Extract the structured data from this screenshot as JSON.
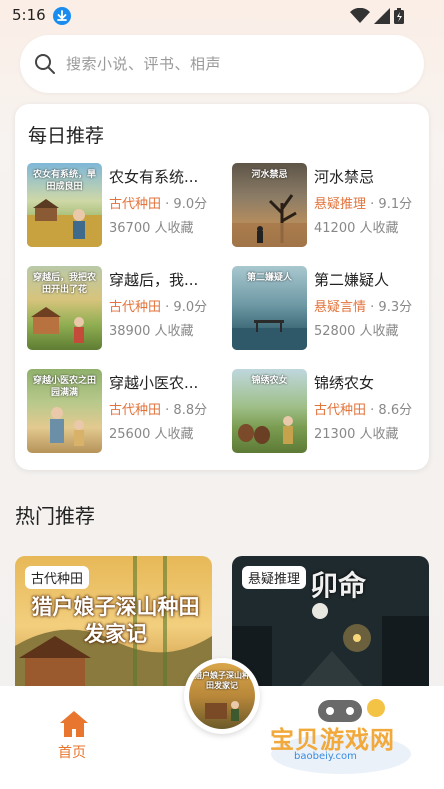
{
  "status_bar": {
    "time": "5:16"
  },
  "search": {
    "placeholder": "搜索小说、评书、相声"
  },
  "daily": {
    "title": "每日推荐",
    "books": [
      {
        "title": "农女有系统...",
        "genre": "古代种田",
        "score": "9.0分",
        "favorites": "36700 人收藏",
        "cover_text": "农女有系统，旱田成良田"
      },
      {
        "title": "河水禁忌",
        "genre": "悬疑推理",
        "score": "9.1分",
        "favorites": "41200 人收藏",
        "cover_text": "河水禁忌"
      },
      {
        "title": "穿越后，我...",
        "genre": "古代种田",
        "score": "9.0分",
        "favorites": "38900 人收藏",
        "cover_text": "穿越后，我把农田开出了花"
      },
      {
        "title": "第二嫌疑人",
        "genre": "悬疑言情",
        "score": "9.3分",
        "favorites": "52800 人收藏",
        "cover_text": "第二嫌疑人"
      },
      {
        "title": "穿越小医农...",
        "genre": "古代种田",
        "score": "8.8分",
        "favorites": "25600 人收藏",
        "cover_text": "穿越小医农之田园满满"
      },
      {
        "title": "锦绣农女",
        "genre": "古代种田",
        "score": "8.6分",
        "favorites": "21300 人收藏",
        "cover_text": "锦绣农女"
      }
    ]
  },
  "hot": {
    "title": "热门推荐",
    "cards": [
      {
        "tag": "古代种田",
        "cover_title": "猎户娘子深山种田发家记"
      },
      {
        "tag": "悬疑推理",
        "cover_title": "卯命"
      }
    ]
  },
  "bottom_nav": {
    "home_label": "首页",
    "center_cover_text": "猎户娘子深山种田发家记"
  },
  "watermark": {
    "text": "宝贝游戏网",
    "url": "baobeiy.com"
  },
  "colors": {
    "accent": "#e8762e",
    "genre": "#e2733b"
  }
}
